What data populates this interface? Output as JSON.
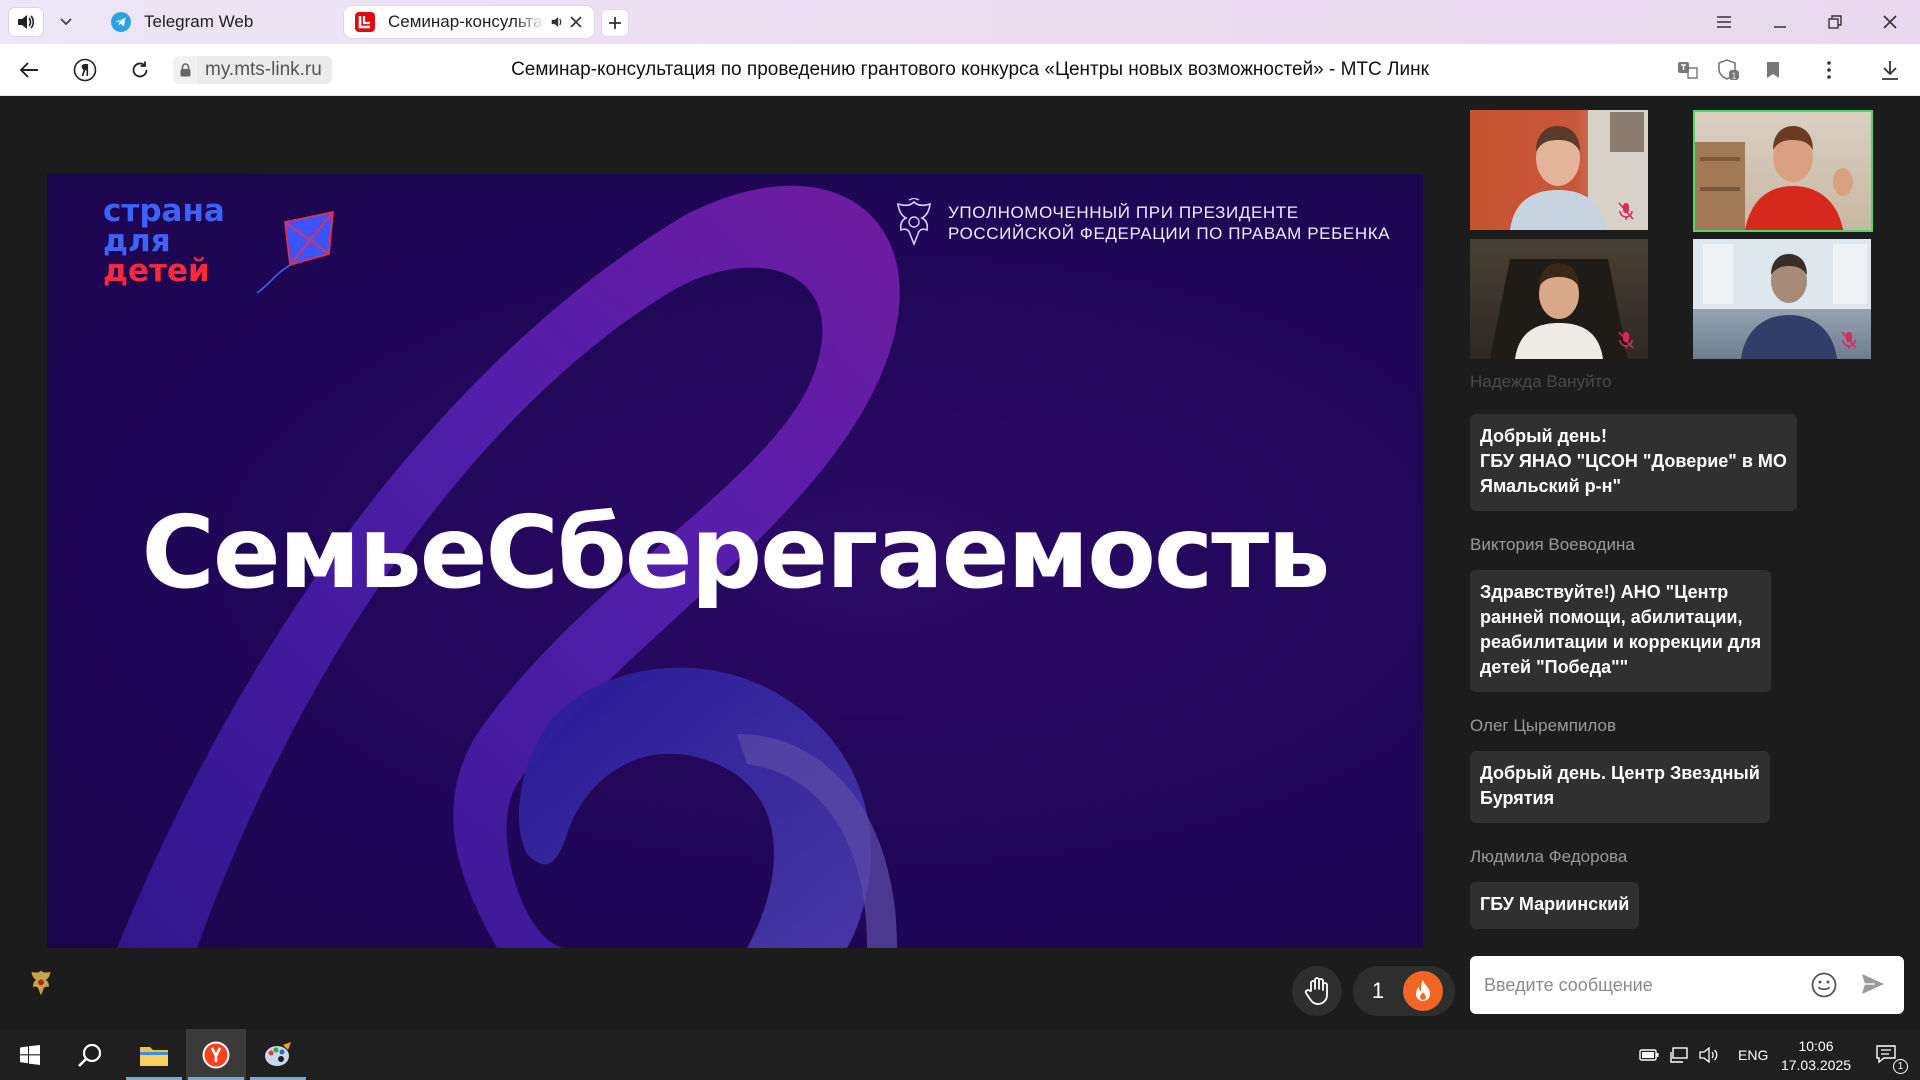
{
  "browser": {
    "tabs": [
      {
        "label": "Telegram Web"
      },
      {
        "label": "Семинар-консультация"
      }
    ],
    "url": "my.mts-link.ru",
    "page_title": "Семинар-консультация по проведению грантового конкурса «Центры новых возможностей» - МТС Линк"
  },
  "slide": {
    "logo_lines": [
      "страна",
      "для",
      "детей"
    ],
    "ombudsman_line1": "УПОЛНОМОЧЕННЫЙ ПРИ ПРЕЗИДЕНТЕ",
    "ombudsman_line2": "РОССИЙСКОЙ ФЕДЕРАЦИИ ПО ПРАВАМ РЕБЕНКА",
    "title": "СемьеСберегаемость"
  },
  "reactions": {
    "count": "1"
  },
  "chat": {
    "faded_author": "Надежда Вануйто",
    "messages": [
      {
        "author": "",
        "text": "Добрый день!\nГБУ ЯНАО \"ЦСОН \"Доверие\" в МО\nЯмальский р-н\""
      },
      {
        "author": "Виктория Воеводина",
        "text": "Здравствуйте!) АНО \"Центр\nранней помощи, абилитации,\nреабилитации и коррекции для\nдетей \"Победа\"\""
      },
      {
        "author": "Олег Цыремпилов",
        "text": "Добрый день. Центр Звездный\nБурятия"
      },
      {
        "author": "Людмила Федорова",
        "text": "ГБУ Мариинский"
      }
    ],
    "input_placeholder": "Введите сообщение"
  },
  "taskbar": {
    "language": "ENG",
    "time": "10:06",
    "date": "17.03.2025",
    "notifications": "1"
  },
  "colors": {
    "slide_bg": "#22075a",
    "brand_blue": "#3d63ff",
    "brand_red": "#ff2a37",
    "active_speaker": "#4cd964",
    "fire": "#f26522"
  }
}
